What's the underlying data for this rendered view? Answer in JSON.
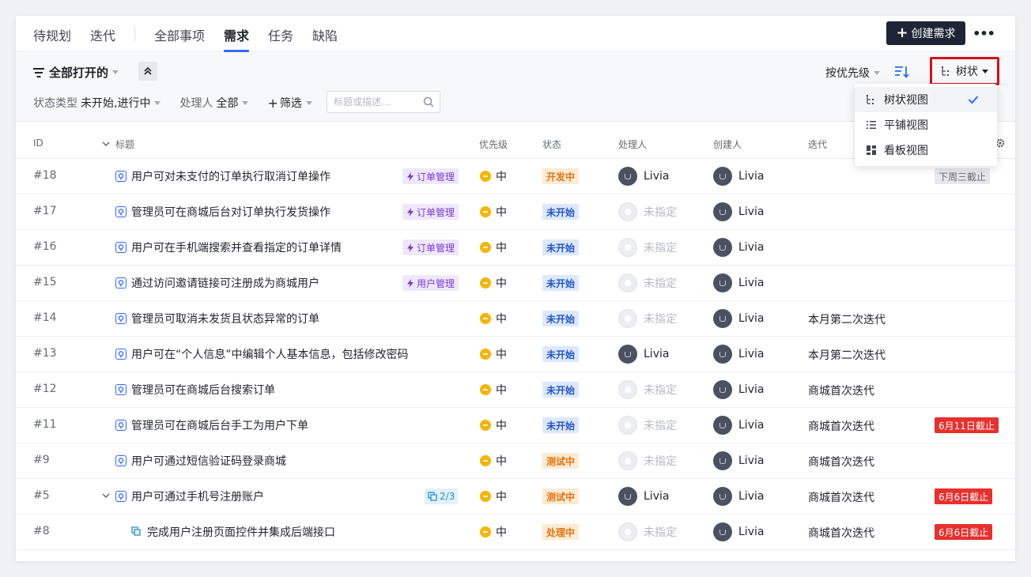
{
  "nav": {
    "items": [
      "待规划",
      "迭代",
      "全部事项",
      "需求",
      "任务",
      "缺陷"
    ],
    "create_label": "创建需求",
    "more": "•••"
  },
  "filter": {
    "view_title": "全部打开的",
    "status_label": "状态类型",
    "status_value": "未开始,进行中",
    "assignee_label": "处理人",
    "assignee_value": "全部",
    "add_filter": "筛选",
    "search_placeholder": "标题或描述...",
    "sort_label": "按优先级",
    "view_mode": "树状"
  },
  "dropdown": {
    "items": [
      "树状视图",
      "平铺视图",
      "看板视图"
    ],
    "selected": "树状视图"
  },
  "table": {
    "headers": {
      "id": "ID",
      "title": "标题",
      "priority": "优先级",
      "status": "状态",
      "assignee": "处理人",
      "creator": "创建人",
      "iteration": "迭代"
    },
    "rows": [
      {
        "id": "#18",
        "title": "用户可对未支付的订单执行取消订单操作",
        "tag": "订单管理",
        "priority": "中",
        "status": "开发中",
        "assignee": "Livia",
        "creator": "Livia",
        "iteration": "",
        "due": "下周三截止"
      },
      {
        "id": "#17",
        "title": "管理员可在商城后台对订单执行发货操作",
        "tag": "订单管理",
        "priority": "中",
        "status": "未开始",
        "assignee": "未指定",
        "creator": "Livia",
        "iteration": "",
        "due": ""
      },
      {
        "id": "#16",
        "title": "用户可在手机端搜索并查看指定的订单详情",
        "tag": "订单管理",
        "priority": "中",
        "status": "未开始",
        "assignee": "未指定",
        "creator": "Livia",
        "iteration": "",
        "due": ""
      },
      {
        "id": "#15",
        "title": "通过访问邀请链接可注册成为商城用户",
        "tag": "用户管理",
        "priority": "中",
        "status": "未开始",
        "assignee": "未指定",
        "creator": "Livia",
        "iteration": "",
        "due": ""
      },
      {
        "id": "#14",
        "title": "管理员可取消未发货且状态异常的订单",
        "tag": "",
        "priority": "中",
        "status": "未开始",
        "assignee": "未指定",
        "creator": "Livia",
        "iteration": "本月第二次迭代",
        "due": ""
      },
      {
        "id": "#13",
        "title": "用户可在“个人信息”中编辑个人基本信息，包括修改密码",
        "tag": "",
        "priority": "中",
        "status": "未开始",
        "assignee": "Livia",
        "creator": "Livia",
        "iteration": "本月第二次迭代",
        "due": ""
      },
      {
        "id": "#12",
        "title": "管理员可在商城后台搜索订单",
        "tag": "",
        "priority": "中",
        "status": "未开始",
        "assignee": "未指定",
        "creator": "Livia",
        "iteration": "商城首次迭代",
        "due": ""
      },
      {
        "id": "#11",
        "title": "管理员可在商城后台手工为用户下单",
        "tag": "",
        "priority": "中",
        "status": "未开始",
        "assignee": "未指定",
        "creator": "Livia",
        "iteration": "商城首次迭代",
        "due": "6月11日截止"
      },
      {
        "id": "#9",
        "title": "用户可通过短信验证码登录商城",
        "tag": "",
        "priority": "中",
        "status": "测试中",
        "assignee": "未指定",
        "creator": "Livia",
        "iteration": "商城首次迭代",
        "due": ""
      },
      {
        "id": "#5",
        "title": "用户可通过手机号注册账户",
        "tag": "",
        "subtask": "2/3",
        "priority": "中",
        "status": "测试中",
        "assignee": "Livia",
        "creator": "Livia",
        "iteration": "商城首次迭代",
        "due": "6月6日截止"
      },
      {
        "id": "#8",
        "title": "完成用户注册页面控件并集成后端接口",
        "tag": "",
        "priority": "中",
        "status": "处理中",
        "assignee": "未指定",
        "creator": "Livia",
        "iteration": "商城首次迭代",
        "due": "6月6日截止"
      }
    ]
  },
  "colors": {
    "accent": "#2f6bff",
    "highlight_border": "#d40f1a",
    "due_red": "#e8302e",
    "priority_mid": "#f7b400"
  }
}
